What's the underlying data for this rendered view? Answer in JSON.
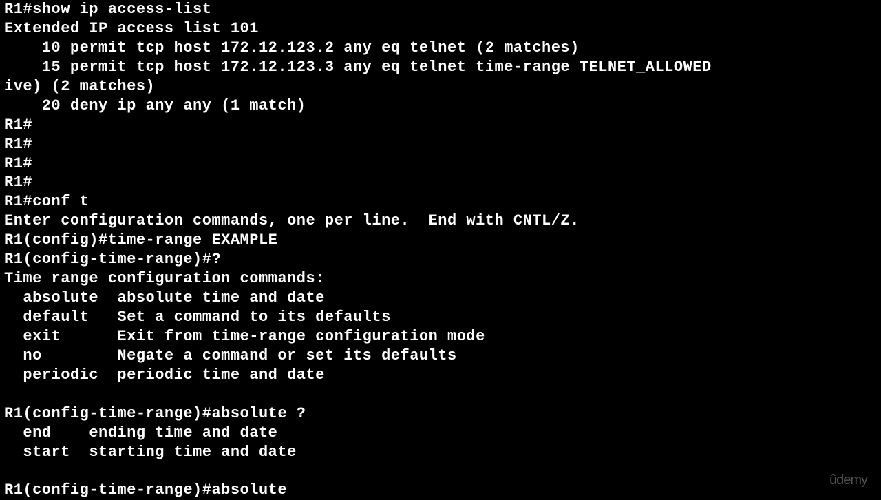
{
  "terminal": {
    "lines": [
      "R1#show ip access-list",
      "Extended IP access list 101",
      "    10 permit tcp host 172.12.123.2 any eq telnet (2 matches)",
      "    15 permit tcp host 172.12.123.3 any eq telnet time-range TELNET_ALLOWED",
      "ive) (2 matches)",
      "    20 deny ip any any (1 match)",
      "R1#",
      "R1#",
      "R1#",
      "R1#",
      "R1#conf t",
      "Enter configuration commands, one per line.  End with CNTL/Z.",
      "R1(config)#time-range EXAMPLE",
      "R1(config-time-range)#?",
      "Time range configuration commands:",
      "  absolute  absolute time and date",
      "  default   Set a command to its defaults",
      "  exit      Exit from time-range configuration mode",
      "  no        Negate a command or set its defaults",
      "  periodic  periodic time and date",
      "",
      "R1(config-time-range)#absolute ?",
      "  end    ending time and date",
      "  start  starting time and date",
      "",
      "R1(config-time-range)#absolute"
    ]
  },
  "watermark": {
    "text": "ûdemy"
  }
}
